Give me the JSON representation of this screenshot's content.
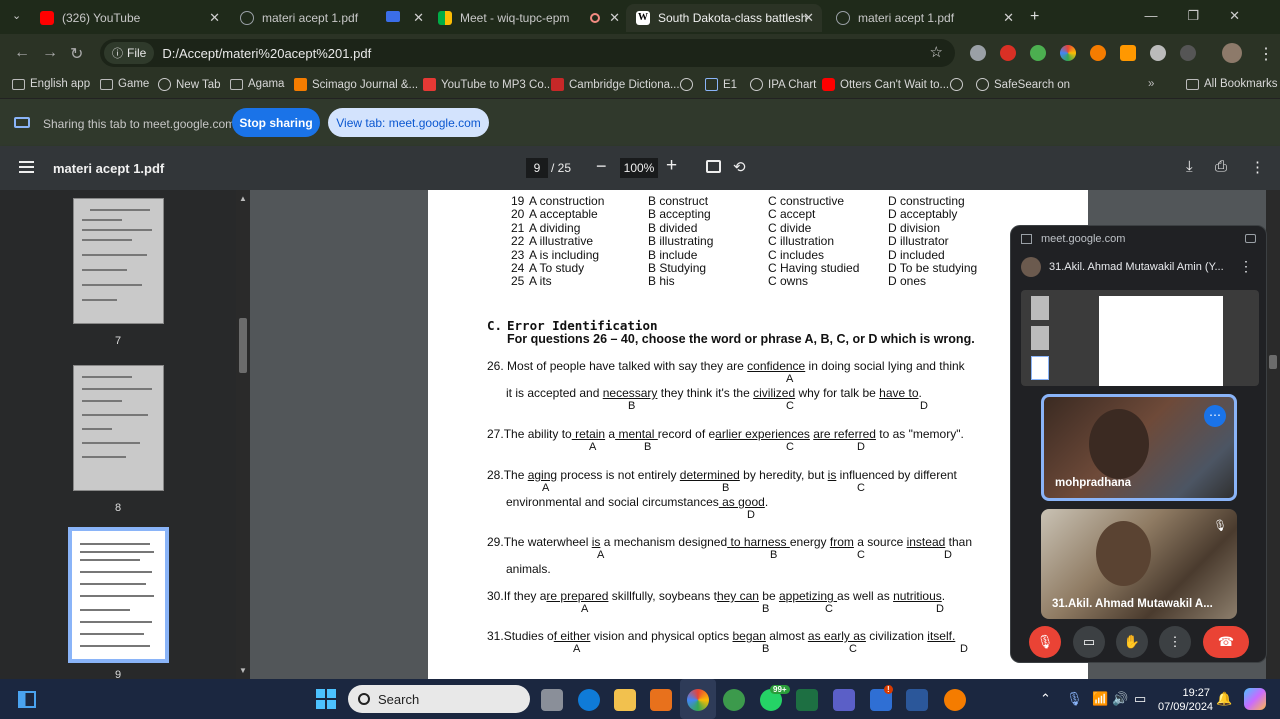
{
  "tabs": [
    {
      "label": "(326) YouTube",
      "color": "#ff0000"
    },
    {
      "label": "materi acept 1.pdf",
      "color": "#9aa0a6"
    },
    {
      "label": "Meet - wiq-tupc-epm",
      "color": "#00ac47"
    },
    {
      "label": "South Dakota-class battleship (",
      "color": "#ffffff"
    },
    {
      "label": "materi acept 1.pdf",
      "color": "#9aa0a6"
    }
  ],
  "omnibox": {
    "chip": "File",
    "url": "D:/Accept/materi%20acept%201.pdf"
  },
  "bookmarks": [
    {
      "label": "English app"
    },
    {
      "label": "Game"
    },
    {
      "label": "New Tab"
    },
    {
      "label": "Agama"
    },
    {
      "label": "Scimago Journal &..."
    },
    {
      "label": "YouTube to MP3 Co..."
    },
    {
      "label": "Cambridge Dictiona..."
    },
    {
      "label": "E1"
    },
    {
      "label": "IPA Chart"
    },
    {
      "label": "Otters Can't Wait to..."
    },
    {
      "label": "SafeSearch on"
    },
    {
      "label": "All Bookmarks"
    }
  ],
  "share": {
    "message": "Sharing this tab to meet.google.com",
    "stop": "Stop sharing",
    "view": "View tab: meet.google.com"
  },
  "pdf": {
    "title": "materi acept 1.pdf",
    "page": "9",
    "total": "/ 25",
    "zoom": "100%"
  },
  "thumbs": [
    "7",
    "8",
    "9"
  ],
  "answers": [
    {
      "n": "19",
      "a": "A construction",
      "b": "B construct",
      "c": "C constructive",
      "d": "D constructing"
    },
    {
      "n": "20",
      "a": "A acceptable",
      "b": "B accepting",
      "c": "C accept",
      "d": "D acceptably"
    },
    {
      "n": "21",
      "a": "A dividing",
      "b": "B divided",
      "c": "C divide",
      "d": "D division"
    },
    {
      "n": "22",
      "a": "A illustrative",
      "b": "B illustrating",
      "c": "C illustration",
      "d": "D illustrator"
    },
    {
      "n": "23",
      "a": "A is including",
      "b": "B include",
      "c": "C includes",
      "d": "D included"
    },
    {
      "n": "24",
      "a": "A To study",
      "b": "B Studying",
      "c": "C Having studied",
      "d": "D To be studying"
    },
    {
      "n": "25",
      "a": "A its",
      "b": "B his",
      "c": "C owns",
      "d": "D ones"
    }
  ],
  "section": {
    "label": "C.",
    "title": "Error Identification",
    "instruction": "For questions 26 – 40, choose the word or phrase A, B, C, or D which is wrong."
  },
  "questions": {
    "q26": {
      "num": "26.",
      "p1": "Most of people have talked with say they are ",
      "u1": "confidence",
      "p2": " in doing social lying and think",
      "l2a": "it is accepted and ",
      "u2": "necessary",
      "l2b": " they think it's the ",
      "u3": "civilized",
      "l2c": " why for talk be ",
      "u4": "have to",
      "l2d": "."
    },
    "q27": {
      "num": "27.",
      "p1": "The ability to",
      "u1": " retain",
      "p2": " a",
      "u2": " mental ",
      "p3": "record of e",
      "u3": "arlier experiences",
      "p4": " ",
      "u4": "are referred",
      "p5": " to as \"memory\"."
    },
    "q28": {
      "num": "28.",
      "p1": "The ",
      "u1": "aging",
      "p2": " process is not entirely ",
      "u2": "determined",
      "p3": " by heredity, but ",
      "u3": "is",
      "p4": " influenced by different",
      "l2a": "environmental and social circumstances",
      "u4": " as good",
      "l2b": "."
    },
    "q29": {
      "num": "29.",
      "p1": "The waterwheel ",
      "u1": "is",
      "p2": " a mechanism designed",
      "u2": " to harness ",
      "p3": "energy ",
      "u3": "from",
      "p4": " a source ",
      "u4": "instead",
      "p5": " than",
      "l2": "animals."
    },
    "q30": {
      "num": "30.",
      "p1": "If they a",
      "u1": "re prepared",
      "p2": " skillfully, soybeans t",
      "u2": "hey can",
      "p3": " be ",
      "u3": "appetizing ",
      "p4": "as well as ",
      "u4": "nutritious",
      "p5": "."
    },
    "q31": {
      "num": "31.",
      "p1": "Studies o",
      "u1": "f either",
      "p2": " vision and physical optics ",
      "u2": "began",
      "p3": " almost ",
      "u3": "as early as",
      "p4": " civilization ",
      "u4": "itself.",
      "p5": ""
    }
  },
  "letters": {
    "a": "A",
    "b": "B",
    "c": "C",
    "d": "D"
  },
  "meet": {
    "origin": "meet.google.com",
    "presenter": "31.Akil. Ahmad Mutawakil Amin (Y...",
    "tile1_name": "mohpradhana",
    "tile2_name": "31.Akil. Ahmad Mutawakil A..."
  },
  "taskbar": {
    "search": "Search",
    "time": "19:27",
    "date": "07/09/2024",
    "badge_whatsapp": "99+",
    "badge_tasks": "!"
  }
}
